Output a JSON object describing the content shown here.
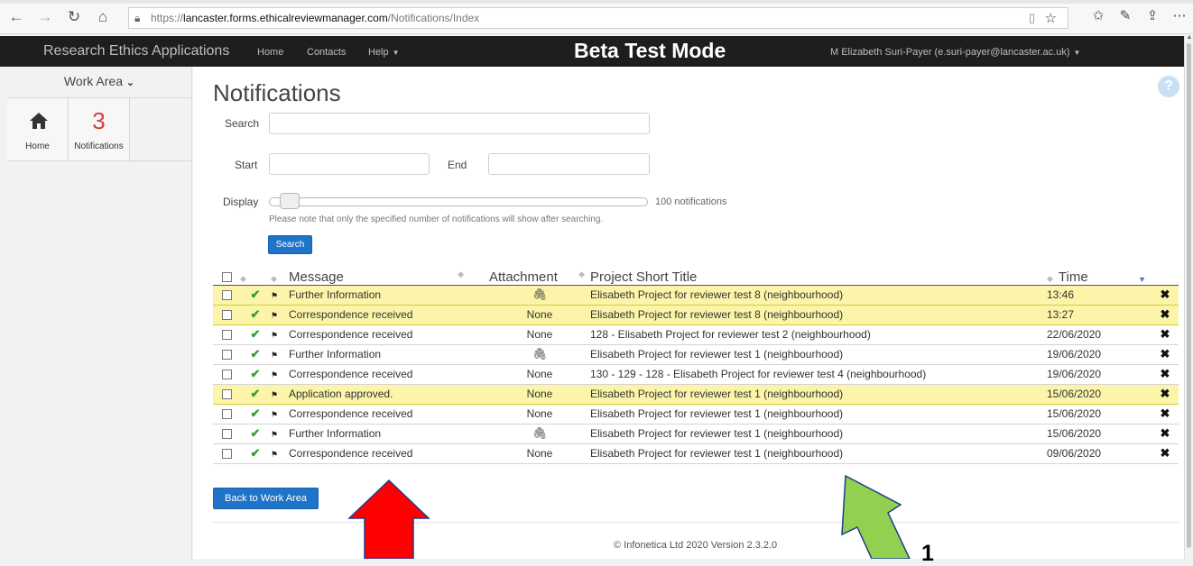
{
  "browser": {
    "url_prefix": "https://",
    "url_domain": "lancaster.forms.ethicalreviewmanager.com",
    "url_path": "/Notifications/Index"
  },
  "navbar": {
    "brand": "Research Ethics Applications",
    "links": [
      "Home",
      "Contacts",
      "Help"
    ],
    "mode_banner": "Beta Test Mode",
    "user": "M Elizabeth Suri-Payer (e.suri-payer@lancaster.ac.uk)"
  },
  "sidebar": {
    "work_area_label": "Work Area",
    "tiles": [
      {
        "label": "Home",
        "icon": "home-icon"
      },
      {
        "label": "Notifications",
        "count": "3"
      }
    ]
  },
  "main": {
    "title": "Notifications",
    "help_icon": "?",
    "search_label": "Search",
    "start_label": "Start",
    "end_label": "End",
    "display_label": "Display",
    "display_count": "100 notifications",
    "display_level": 0.03,
    "note": "Please note that only the specified number of notifications will show after searching.",
    "search_button": "Search",
    "back_button": "Back to Work Area",
    "footer": "© Infonetica Ltd 2020 Version 2.3.2.0"
  },
  "table": {
    "headers": [
      "Message",
      "Attachment",
      "Project Short Title",
      "Time"
    ],
    "rows": [
      {
        "message": "Further Information",
        "attachment": "paperclip",
        "project": "Elisabeth Project for reviewer test 8 (neighbourhood)",
        "time": "13:46",
        "highlighted": true
      },
      {
        "message": "Correspondence received",
        "attachment": "None",
        "project": "Elisabeth Project for reviewer test 8 (neighbourhood)",
        "time": "13:27",
        "highlighted": true
      },
      {
        "message": "Correspondence received",
        "attachment": "None",
        "project": "128 - Elisabeth Project for reviewer test 2 (neighbourhood)",
        "time": "22/06/2020",
        "highlighted": false
      },
      {
        "message": "Further Information",
        "attachment": "paperclip",
        "project": "Elisabeth Project for reviewer test 1 (neighbourhood)",
        "time": "19/06/2020",
        "highlighted": false
      },
      {
        "message": "Correspondence received",
        "attachment": "None",
        "project": "130 - 129 - 128 - Elisabeth Project for reviewer test 4 (neighbourhood)",
        "time": "19/06/2020",
        "highlighted": false
      },
      {
        "message": "Application approved.",
        "attachment": "None",
        "project": "Elisabeth Project for reviewer test 1 (neighbourhood)",
        "time": "15/06/2020",
        "highlighted": true
      },
      {
        "message": "Correspondence received",
        "attachment": "None",
        "project": "Elisabeth Project for reviewer test 1 (neighbourhood)",
        "time": "15/06/2020",
        "highlighted": false
      },
      {
        "message": "Further Information",
        "attachment": "paperclip",
        "project": "Elisabeth Project for reviewer test 1 (neighbourhood)",
        "time": "15/06/2020",
        "highlighted": false
      },
      {
        "message": "Correspondence received",
        "attachment": "None",
        "project": "Elisabeth Project for reviewer test 1 (neighbourhood)",
        "time": "09/06/2020",
        "highlighted": false
      }
    ]
  },
  "annotations": {
    "red_arrow_color": "#ff0000",
    "green_arrow_color": "#92d050",
    "label": "1"
  },
  "colors": {
    "accent": "#1f73c9",
    "highlight_row": "#fcf4a8",
    "navbar": "#1e1e1e",
    "count": "#d43f3a"
  }
}
